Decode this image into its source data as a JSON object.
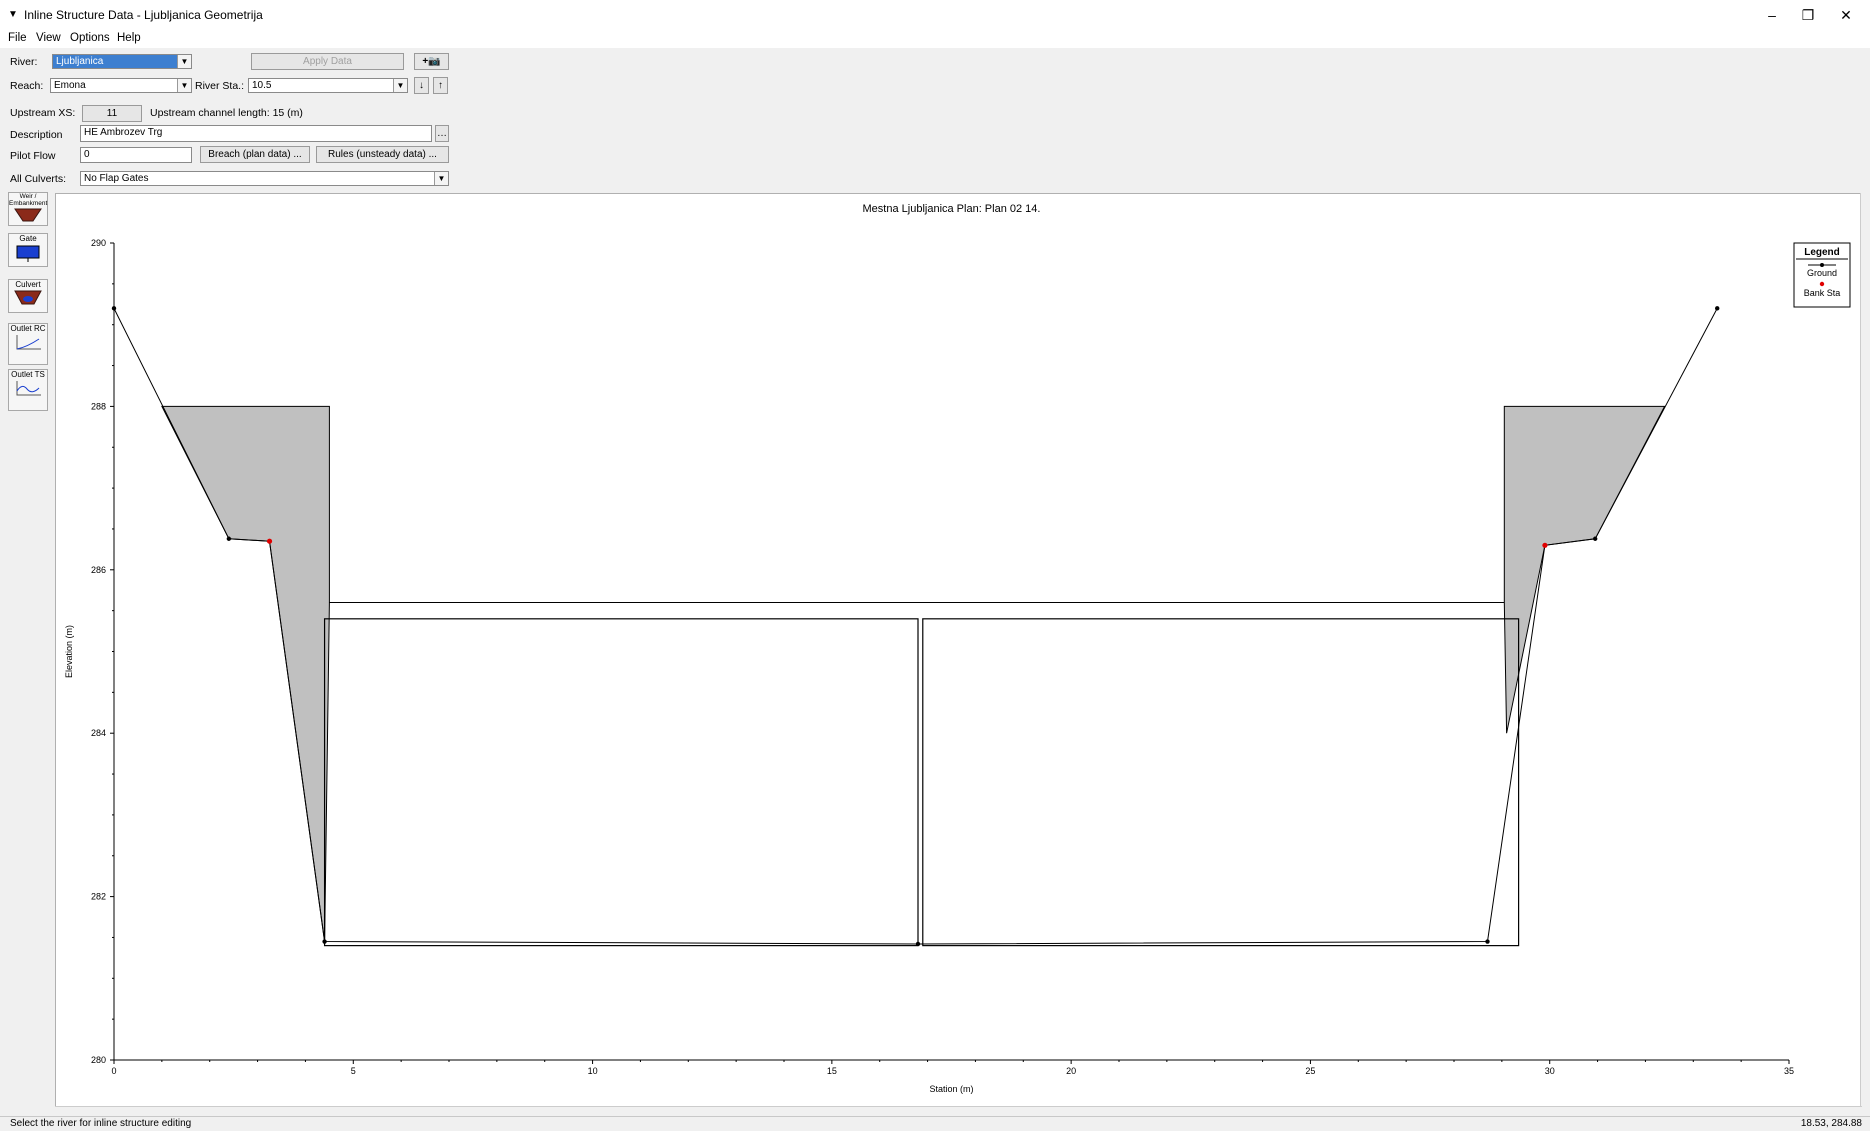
{
  "window": {
    "title": "Inline Structure Data - Ljubljanica Geometrija",
    "minimize": "–",
    "restore": "❐",
    "close": "✕"
  },
  "menu": [
    "File",
    "View",
    "Options",
    "Help"
  ],
  "form": {
    "river_label": "River:",
    "river_value": "Ljubljanica",
    "apply_label": "Apply Data",
    "reach_label": "Reach:",
    "reach_value": "Emona",
    "station_label": "River Sta.:",
    "station_value": "10.5",
    "upstream_xs_label": "Upstream XS:",
    "upstream_xs_value": "11",
    "channel_length_label": "Upstream channel length: 15 (m)",
    "description_label": "Description",
    "description_value": "HE Ambrozev Trg",
    "pilot_flow_label": "Pilot Flow",
    "pilot_flow_value": "0",
    "breach_label": "Breach (plan data) ...",
    "rules_label": "Rules (unsteady data) ...",
    "culverts_label": "All Culverts:",
    "culverts_value": "No Flap Gates",
    "add_icon": "add-icon",
    "camera_icon": "camera-icon"
  },
  "toolbar": [
    {
      "label": "Weir / Embankment",
      "icon": "weir-icon"
    },
    {
      "label": "Gate",
      "icon": "gate-icon"
    },
    {
      "label": "Culvert",
      "icon": "culvert-icon"
    },
    {
      "label": "Outlet RC",
      "icon": "outlet-rc-icon"
    },
    {
      "label": "Outlet TS",
      "icon": "outlet-ts-icon"
    }
  ],
  "status": {
    "message": "Select the river for inline structure editing",
    "coords": "18.53, 284.88"
  },
  "chart_data": {
    "type": "cross-section",
    "title": "Mestna Ljubljanica      Plan: Plan 02    14.",
    "xlabel": "Station (m)",
    "ylabel": "Elevation (m)",
    "xlim": [
      0,
      35
    ],
    "ylim": [
      280,
      290
    ],
    "xticks": [
      0,
      5,
      10,
      15,
      20,
      25,
      30,
      35
    ],
    "yticks": [
      280,
      282,
      284,
      286,
      288,
      290
    ],
    "legend": {
      "title": "Legend",
      "items": [
        "Ground",
        "Bank Sta"
      ],
      "placement": "top-right"
    },
    "ground": [
      [
        0,
        289.2
      ],
      [
        2.4,
        286.38
      ],
      [
        3.25,
        286.35
      ],
      [
        4.4,
        281.45
      ],
      [
        16.8,
        281.42
      ],
      [
        28.7,
        281.45
      ],
      [
        29.9,
        286.3
      ],
      [
        30.95,
        286.38
      ],
      [
        33.5,
        289.2
      ]
    ],
    "bank_stations": [
      [
        3.25,
        286.35
      ],
      [
        29.9,
        286.3
      ]
    ],
    "weir_fill": {
      "left": [
        [
          1.0,
          288.0
        ],
        [
          4.5,
          288.0
        ],
        [
          4.5,
          285.6
        ],
        [
          4.4,
          281.45
        ],
        [
          3.25,
          286.35
        ],
        [
          2.4,
          286.38
        ]
      ],
      "right": [
        [
          29.05,
          288.0
        ],
        [
          32.4,
          288.0
        ],
        [
          30.95,
          286.38
        ],
        [
          29.9,
          286.3
        ],
        [
          29.1,
          284.0
        ],
        [
          29.05,
          285.6
        ]
      ]
    },
    "deck": {
      "x": [
        4.5,
        29.05
      ],
      "low_chord": 285.6
    },
    "culverts": [
      {
        "x": [
          4.4,
          16.8
        ],
        "bottom": 281.4,
        "top": 285.4
      },
      {
        "x": [
          16.9,
          29.35
        ],
        "bottom": 281.4,
        "top": 285.4
      }
    ]
  }
}
